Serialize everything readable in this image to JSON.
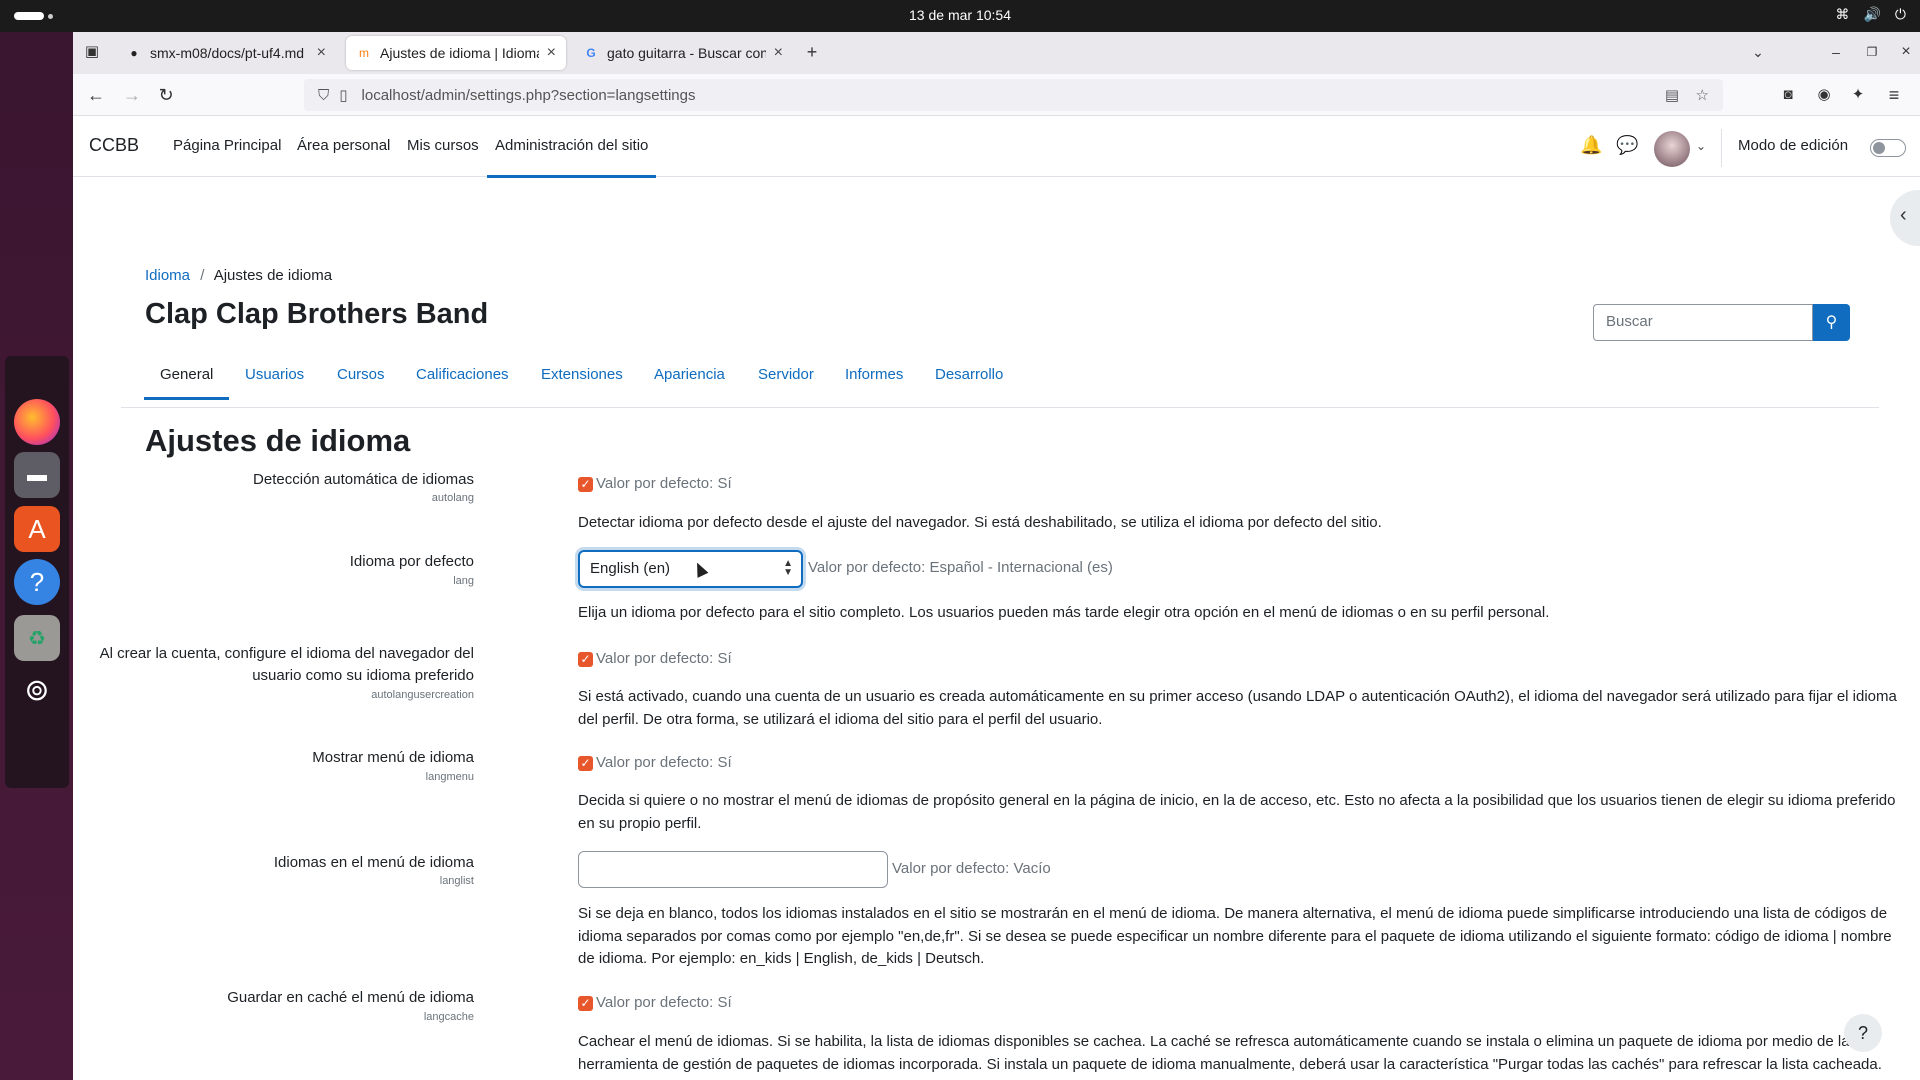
{
  "os": {
    "clock": "13 de mar  10:54"
  },
  "browser": {
    "tabs": [
      {
        "title": "smx-m08/docs/pt-uf4.md",
        "icon": "github-icon",
        "active": false
      },
      {
        "title": "Ajustes de idioma | Idioma",
        "icon": "moodle-icon",
        "active": true
      },
      {
        "title": "gato guitarra - Buscar con",
        "icon": "google-icon",
        "active": false
      }
    ],
    "url": "localhost/admin/settings.php?section=langsettings"
  },
  "moodle": {
    "brand": "CCBB",
    "nav": [
      "Página Principal",
      "Área personal",
      "Mis cursos",
      "Administración del sitio"
    ],
    "edit_mode_label": "Modo de edición",
    "breadcrumb": {
      "parent": "Idioma",
      "sep": "/",
      "current": "Ajustes de idioma"
    },
    "site_title": "Clap Clap Brothers Band",
    "search_placeholder": "Buscar",
    "subnav": [
      "General",
      "Usuarios",
      "Cursos",
      "Calificaciones",
      "Extensiones",
      "Apariencia",
      "Servidor",
      "Informes",
      "Desarrollo"
    ],
    "section_title": "Ajustes de idioma",
    "settings": [
      {
        "label": "Detección automática de idiomas",
        "key": "autolang",
        "checked": true,
        "default": "Valor por defecto: Sí",
        "desc": "Detectar idioma por defecto desde el ajuste del navegador. Si está deshabilitado, se utiliza el idioma por defecto del sitio."
      },
      {
        "label": "Idioma por defecto",
        "key": "lang",
        "select_value": "English (en)",
        "default": "Valor por defecto: Español - Internacional (es)",
        "desc": "Elija un idioma por defecto para el sitio completo. Los usuarios pueden más tarde elegir otra opción en el menú de idiomas o en su perfil personal."
      },
      {
        "label_line1": "Al crear la cuenta, configure el idioma del navegador del",
        "label_line2": "usuario como su idioma preferido",
        "key": "autolangusercreation",
        "checked": true,
        "default": "Valor por defecto: Sí",
        "desc": "Si está activado, cuando una cuenta de un usuario es creada automáticamente en su primer acceso (usando LDAP o autenticación OAuth2), el idioma del navegador será utilizado para fijar el idioma del perfil. De otra forma, se utilizará el idioma del sitio para el perfil del usuario."
      },
      {
        "label": "Mostrar menú de idioma",
        "key": "langmenu",
        "checked": true,
        "default": "Valor por defecto: Sí",
        "desc": "Decida si quiere o no mostrar el menú de idiomas de propósito general en la página de inicio, en la de acceso, etc. Esto no afecta a la posibilidad que los usuarios tienen de elegir su idioma preferido en su propio perfil."
      },
      {
        "label": "Idiomas en el menú de idioma",
        "key": "langlist",
        "input_value": "",
        "default": "Valor por defecto: Vacío",
        "desc": "Si se deja en blanco, todos los idiomas instalados en el sitio se mostrarán en el menú de idioma. De manera alternativa, el menú de idioma puede simplificarse introduciendo una lista de códigos de idioma separados por comas como por ejemplo \"en,de,fr\". Si se desea se puede especificar un nombre diferente para el paquete de idioma utilizando el siguiente formato: código de idioma | nombre de idioma. Por ejemplo: en_kids | English, de_kids | Deutsch."
      },
      {
        "label": "Guardar en caché el menú de idioma",
        "key": "langcache",
        "checked": true,
        "default": "Valor por defecto: Sí",
        "desc": "Cachear el menú de idiomas. Si se habilita, la lista de idiomas disponibles se cachea. La caché se refresca automáticamente cuando se instala o elimina un paquete de idioma por medio de la herramienta de gestión de paquetes de idiomas incorporada. Si instala un paquete de idioma manualmente, deberá usar la característica \"Purgar todas las cachés\" para refrescar la lista cacheada."
      }
    ],
    "help": "?"
  }
}
